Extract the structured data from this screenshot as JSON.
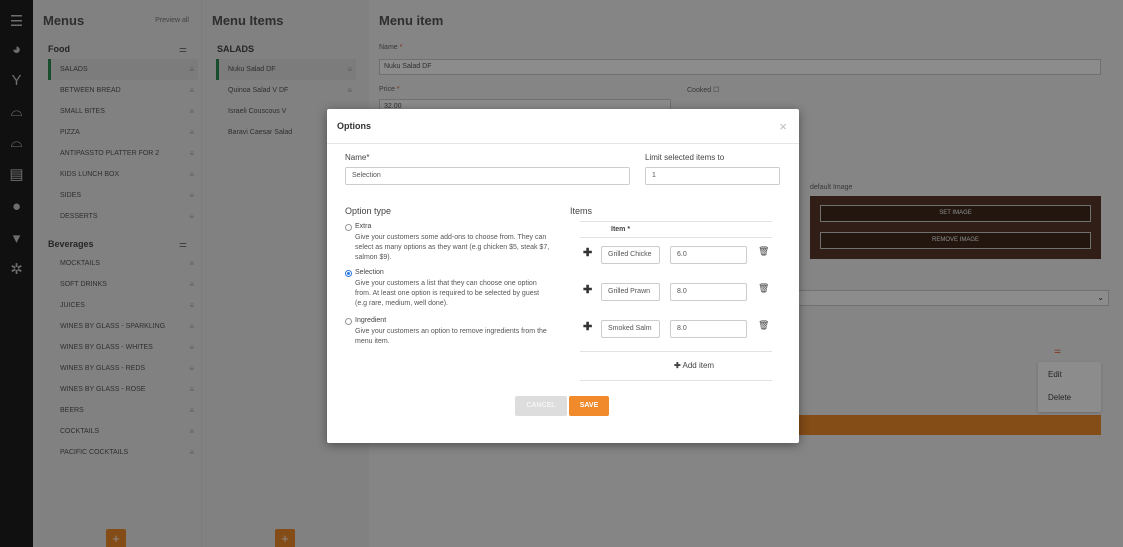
{
  "rail_icons": [
    "menu-icon",
    "dashboard-icon",
    "cocktail-icon",
    "dish-icon",
    "dish-icon",
    "document-icon",
    "user-icon",
    "cart-icon",
    "gear-icon"
  ],
  "menus": {
    "title": "Menus",
    "preview": "Preview all",
    "food_label": "Food",
    "food_items": [
      "SALADS",
      "BETWEEN BREAD",
      "SMALL BITES",
      "PIZZA",
      "ANTIPASSTO PLATTER FOR 2",
      "KIDS LUNCH BOX",
      "SIDES",
      "DESSERTS"
    ],
    "beverages_label": "Beverages",
    "beverage_items": [
      "MOCKTAILS",
      "SOFT DRINKS",
      "JUICES",
      "WINES BY GLASS - SPARKLING",
      "WINES BY GLASS - WHITES",
      "WINES BY GLASS - REDS",
      "WINES BY GLASS - ROSE",
      "BEERS",
      "COCKTAILS",
      "PACIFIC COCKTAILS"
    ]
  },
  "menu_items": {
    "title": "Menu Items",
    "section": "SALADS",
    "items": [
      "Nuku Salad DF",
      "Quinoa Salad V DF",
      "Israeli Couscous V",
      "Baravi Caesar Salad"
    ]
  },
  "detail": {
    "title": "Menu item",
    "name_label": "Name",
    "name_value": "Nuku Salad DF",
    "price_label": "Price",
    "price_value": "32.00",
    "cooked_label": "Cooked",
    "default_image_label": "default Image",
    "set_image": "SET IMAGE",
    "remove_image": "REMOVE IMAGE",
    "ctx_edit": "Edit",
    "ctx_delete": "Delete"
  },
  "modal": {
    "title": "Options",
    "name_label": "Name*",
    "name_value": "Selection",
    "limit_label": "Limit selected items to",
    "limit_value": "1",
    "option_type_label": "Option type",
    "options": [
      {
        "name": "Extra",
        "desc": "Give your customers some add-ons to choose from. They can select as many options as they want (e.g chicken $5, steak $7, salmon $9).",
        "selected": false
      },
      {
        "name": "Selection",
        "desc": "Give your customers a list that they can choose one option from. At least one option is required to be selected by guest (e.g rare, medium, well done).",
        "selected": true
      },
      {
        "name": "Ingredient",
        "desc": "Give your customers an option to remove ingredients from the menu item.",
        "selected": false
      }
    ],
    "items_label": "Items",
    "item_col": "Item *",
    "rows": [
      {
        "name": "Grilled Chicke",
        "price": "6.0"
      },
      {
        "name": "Grilled Prawn",
        "price": "8.0"
      },
      {
        "name": "Smoked Salm",
        "price": "8.0"
      }
    ],
    "add_item": "Add item",
    "cancel": "CANCEL",
    "save": "SAVE"
  },
  "colors": {
    "accent": "#f08a2a",
    "selected_bar": "#2e8b57",
    "radio": "#2b7be4"
  }
}
